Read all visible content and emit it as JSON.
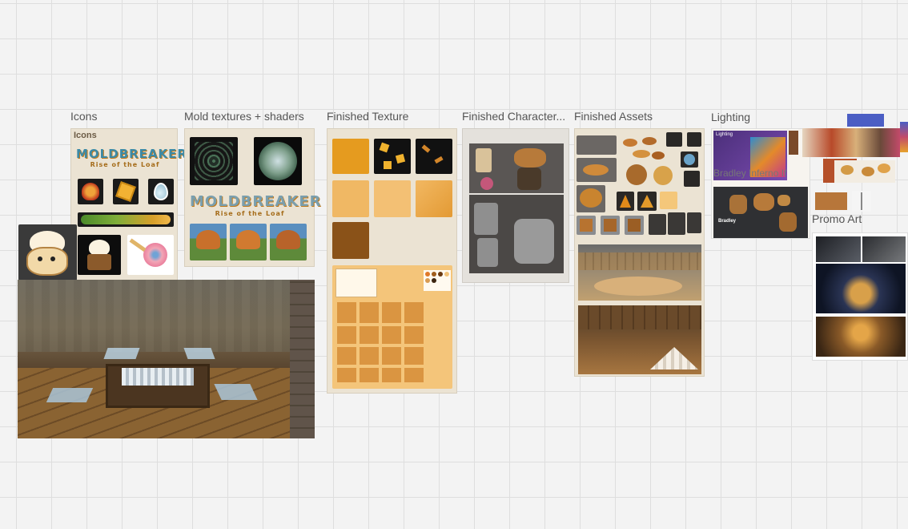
{
  "frames": {
    "icons": {
      "label": "Icons",
      "inner_title": "Icons"
    },
    "mold": {
      "label": "Mold textures + shaders"
    },
    "texture": {
      "label": "Finished Texture"
    },
    "character": {
      "label": "Finished Character..."
    },
    "assets": {
      "label": "Finished Assets"
    },
    "lighting": {
      "label": "Lighting",
      "inner_title": "Lighting",
      "card_label": "Bradley"
    },
    "promo": {
      "label": "Promo Art"
    }
  },
  "logo": {
    "title": "MOLDBREAKER",
    "subtitle": "Rise of the Loaf"
  },
  "overlap_text": "Bradley Inferno If",
  "colors": {
    "canvas": "#f3f3f3",
    "frame_bg": "#ebe3d3",
    "texture_orange": "#e6a22d",
    "dark": "#2b2b2b"
  }
}
